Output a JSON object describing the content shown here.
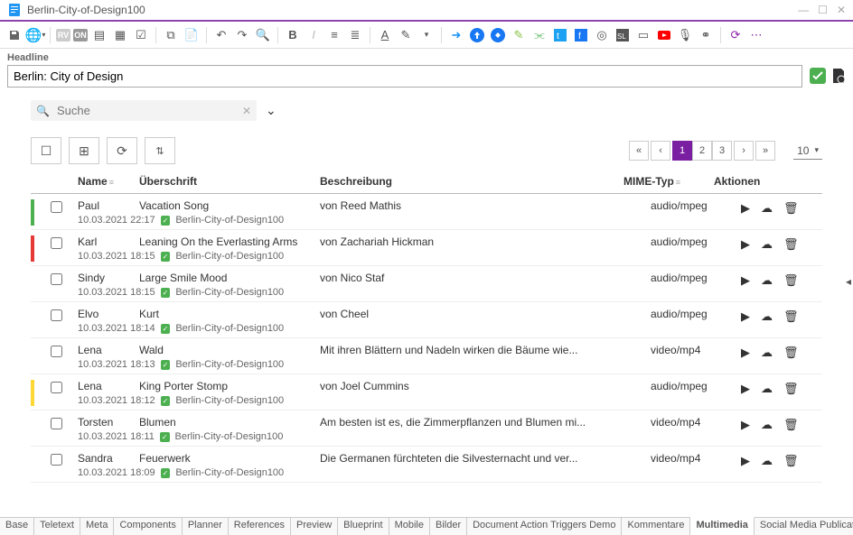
{
  "window": {
    "title": "Berlin-City-of-Design100"
  },
  "headline": {
    "label": "Headline",
    "value": "Berlin: City of Design"
  },
  "search": {
    "placeholder": "Suche"
  },
  "pagination": {
    "pages": [
      "1",
      "2",
      "3"
    ],
    "active_index": 0,
    "size": "10"
  },
  "columns": {
    "name": "Name",
    "title": "Überschrift",
    "desc": "Beschreibung",
    "mime": "MIME-Typ",
    "actions": "Aktionen"
  },
  "source_name": "Berlin-City-of-Design100",
  "rows": [
    {
      "stripe": "#4caf50",
      "name": "Paul",
      "title": "Vacation Song",
      "desc": "von Reed Mathis",
      "mime": "audio/mpeg",
      "ts": "10.03.2021 22:17"
    },
    {
      "stripe": "#e53935",
      "name": "Karl",
      "title": "Leaning On the Everlasting Arms",
      "desc": "von Zachariah Hickman",
      "mime": "audio/mpeg",
      "ts": "10.03.2021 18:15"
    },
    {
      "stripe": "",
      "name": "Sindy",
      "title": "Large Smile Mood",
      "desc": "von Nico Staf",
      "mime": "audio/mpeg",
      "ts": "10.03.2021 18:15"
    },
    {
      "stripe": "",
      "name": "Elvo",
      "title": "Kurt",
      "desc": "von Cheel",
      "mime": "audio/mpeg",
      "ts": "10.03.2021 18:14"
    },
    {
      "stripe": "",
      "name": "Lena",
      "title": "Wald",
      "desc": "Mit ihren Blättern und Nadeln wirken die Bäume wie...",
      "mime": "video/mp4",
      "ts": "10.03.2021 18:13"
    },
    {
      "stripe": "#fdd835",
      "name": "Lena",
      "title": "King Porter Stomp",
      "desc": "von Joel Cummins",
      "mime": "audio/mpeg",
      "ts": "10.03.2021 18:12"
    },
    {
      "stripe": "",
      "name": "Torsten",
      "title": "Blumen",
      "desc": "Am besten ist es, die Zimmerpflanzen und Blumen mi...",
      "mime": "video/mp4",
      "ts": "10.03.2021 18:11"
    },
    {
      "stripe": "",
      "name": "Sandra",
      "title": "Feuerwerk",
      "desc": "Die Germanen fürchteten die Silvesternacht und ver...",
      "mime": "video/mp4",
      "ts": "10.03.2021 18:09"
    }
  ],
  "bottom_tabs": [
    "Base",
    "Teletext",
    "Meta",
    "Components",
    "Planner",
    "References",
    "Preview",
    "Blueprint",
    "Mobile",
    "Bilder",
    "Document Action Triggers Demo",
    "Kommentare",
    "Multimedia",
    "Social Media Publications"
  ],
  "bottom_active": 12
}
